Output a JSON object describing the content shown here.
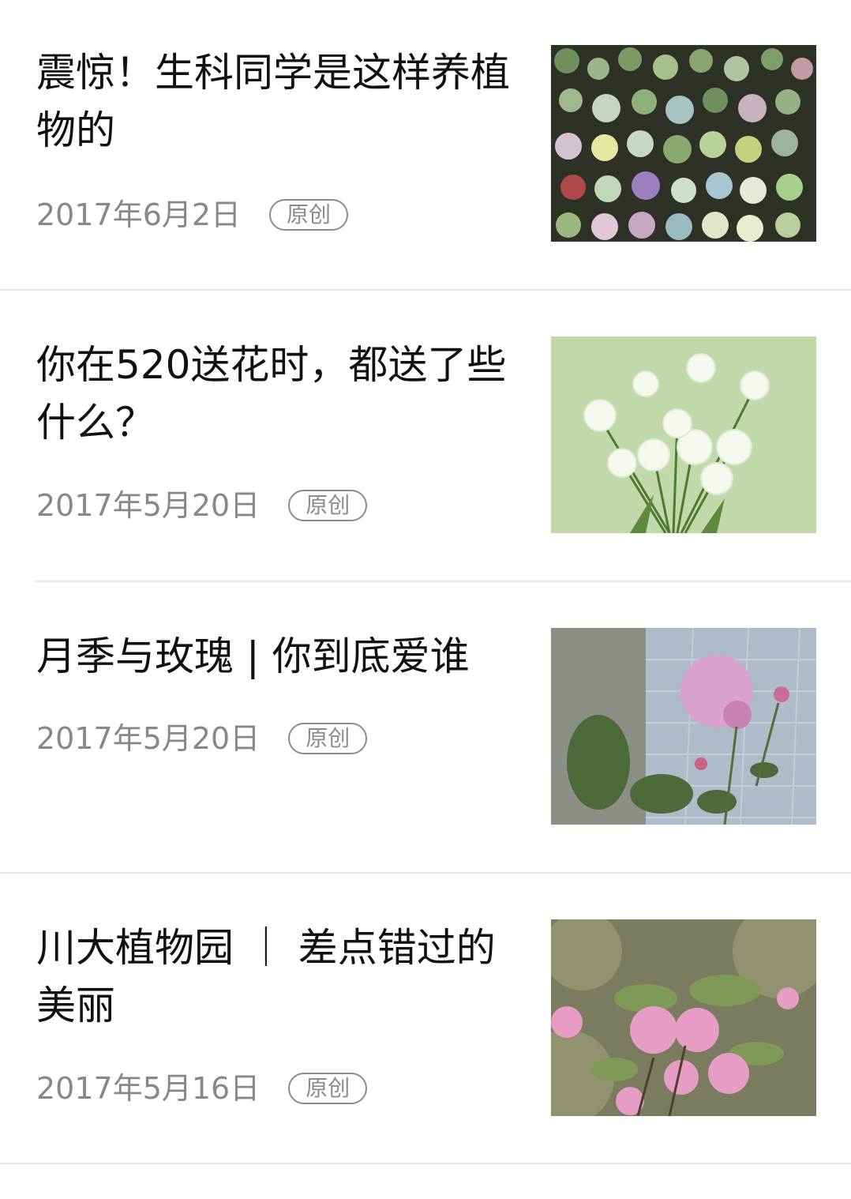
{
  "articles": [
    {
      "title": "震惊！生科同学是这样养植物的",
      "date": "2017年6月2日",
      "badge": "原创",
      "image": "succulents-grid-photo"
    },
    {
      "title": "你在520送花时，都送了些什么？",
      "date": "2017年5月20日",
      "badge": "原创",
      "image": "white-lisianthus-photo"
    },
    {
      "title": "月季与玫瑰 | 你到底爱谁",
      "date": "2017年5月20日",
      "badge": "原创",
      "image": "pink-rose-by-wall-photo"
    },
    {
      "title": "川大植物园 ｜ 差点错过的美丽",
      "date": "2017年5月16日",
      "badge": "原创",
      "image": "pink-cherry-blossom-photo"
    }
  ]
}
